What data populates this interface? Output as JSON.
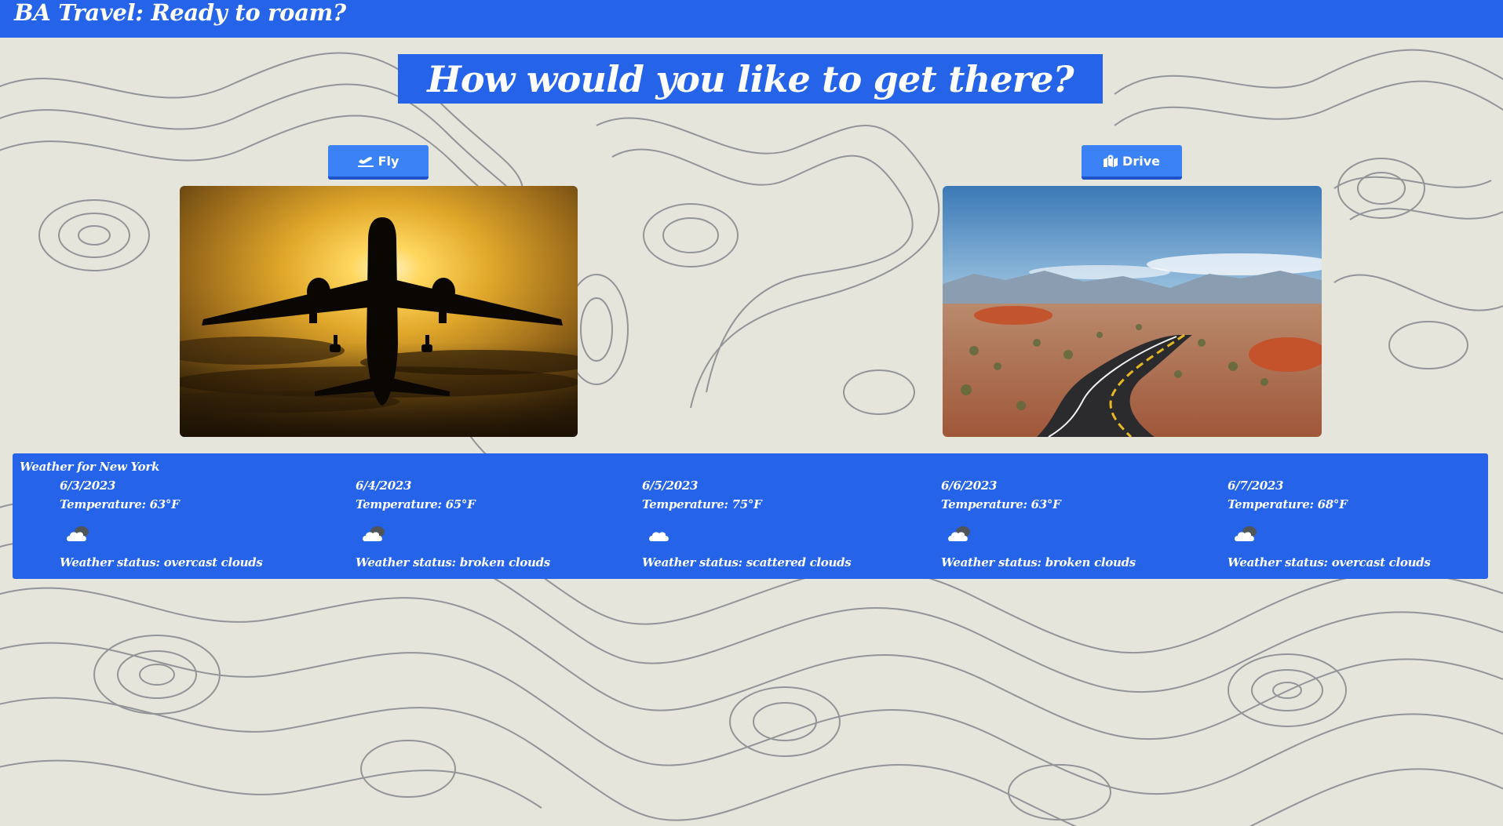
{
  "header": {
    "title": "BA Travel: Ready to roam?"
  },
  "prompt": {
    "question": "How would you like to get there?"
  },
  "modes": {
    "fly_label": "Fly",
    "fly_icon": "plane-departure-icon",
    "drive_label": "Drive",
    "drive_icon": "map-location-icon"
  },
  "weather": {
    "title": "Weather for New York",
    "days": [
      {
        "date": "6/3/2023",
        "temperature": "Temperature: 63°F",
        "icon": "broken-clouds-icon",
        "status": "Weather status: overcast clouds"
      },
      {
        "date": "6/4/2023",
        "temperature": "Temperature: 65°F",
        "icon": "broken-clouds-icon",
        "status": "Weather status: broken clouds"
      },
      {
        "date": "6/5/2023",
        "temperature": "Temperature: 75°F",
        "icon": "scattered-clouds-icon",
        "status": "Weather status: scattered clouds"
      },
      {
        "date": "6/6/2023",
        "temperature": "Temperature: 63°F",
        "icon": "broken-clouds-icon",
        "status": "Weather status: broken clouds"
      },
      {
        "date": "6/7/2023",
        "temperature": "Temperature: 68°F",
        "icon": "broken-clouds-icon",
        "status": "Weather status: overcast clouds"
      }
    ]
  },
  "colors": {
    "accent": "#2563e8",
    "button": "#3b82f6",
    "background": "#e6e5dc",
    "contour_lines": "#8a8c91"
  }
}
